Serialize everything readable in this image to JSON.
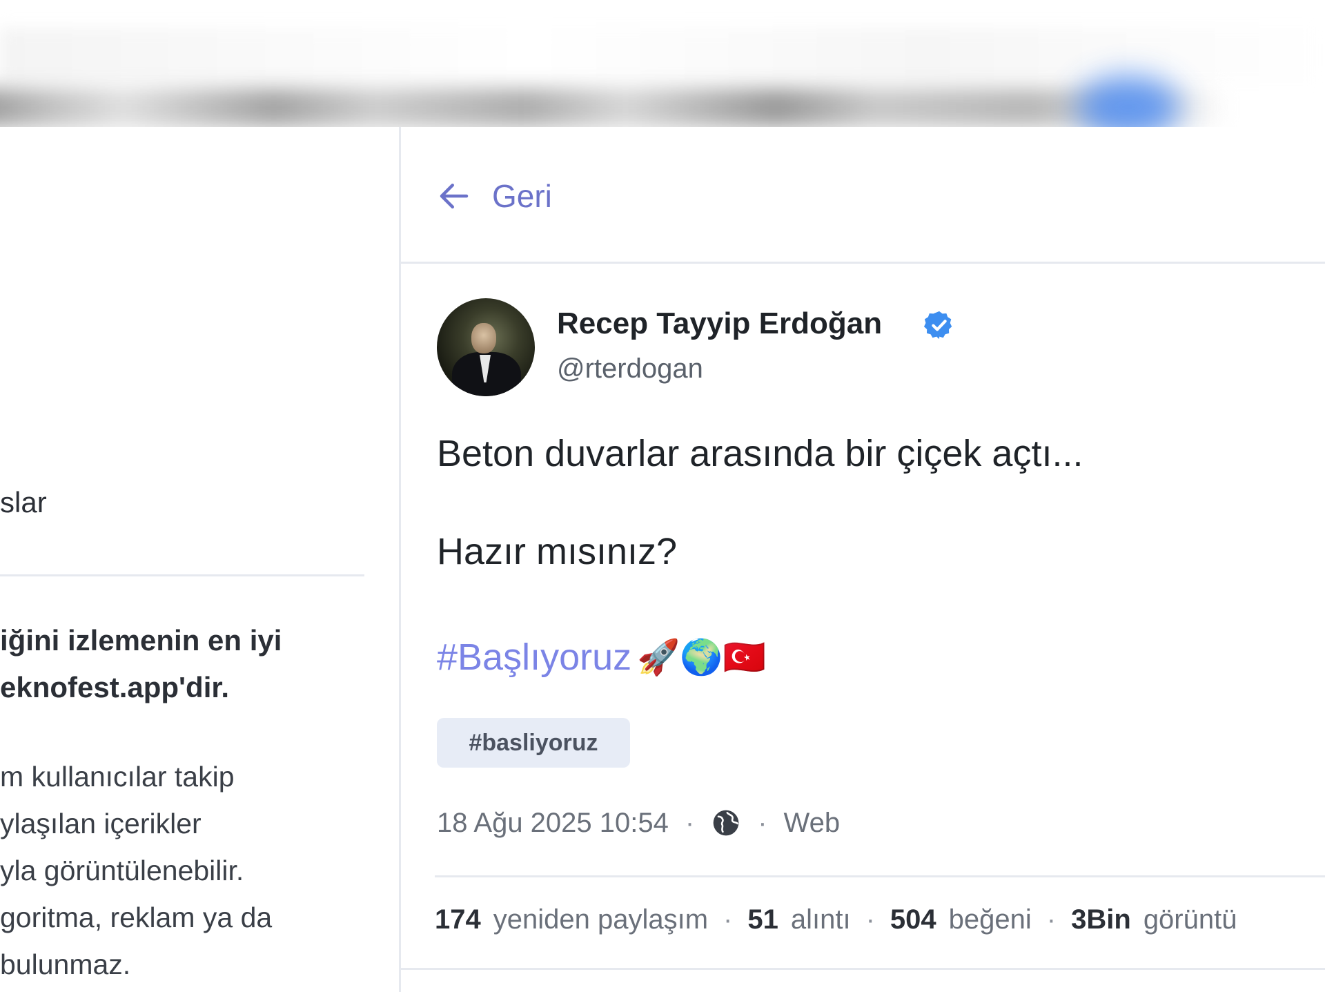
{
  "left_panel": {
    "fragment_1": "slar",
    "bold_line_1": "iğini izlemenin en iyi",
    "bold_line_2": "eknofest.app'dir.",
    "body_line_1": "m kullanıcılar takip",
    "body_line_2": "ylaşılan içerikler",
    "body_line_3": "yla görüntülenebilir.",
    "body_line_4": "goritma, reklam ya da",
    "body_line_5": "bulunmaz."
  },
  "header": {
    "back_label": "Geri",
    "back_icon": "arrow-left-icon"
  },
  "post": {
    "author_name": "Recep Tayyip Erdoğan",
    "author_handle": "@rterdogan",
    "verified_icon": "verified-badge-icon",
    "text_line_1": "Beton duvarlar arasında bir çiçek açtı...",
    "text_line_2": "Hazır mısınız?",
    "hashtag": "#Başlıyoruz",
    "emojis": "🚀🌍🇹🇷",
    "tag_chip": "#basliyoruz",
    "date": "18 Ağu 2025 10:54",
    "visibility_icon": "globe-icon",
    "source": "Web",
    "meta_separator": "·"
  },
  "stats": {
    "reposts_count": "174",
    "reposts_label": "yeniden paylaşım",
    "quotes_count": "51",
    "quotes_label": "alıntı",
    "likes_count": "504",
    "likes_label": "beğeni",
    "views_count": "3Bin",
    "views_label": "görüntü"
  },
  "colors": {
    "accent": "#6b72c9",
    "hashtag": "#7b84e6",
    "verified": "#3d8ef0",
    "chip_bg": "#e7ecf6",
    "divider": "#e6e9ef"
  }
}
